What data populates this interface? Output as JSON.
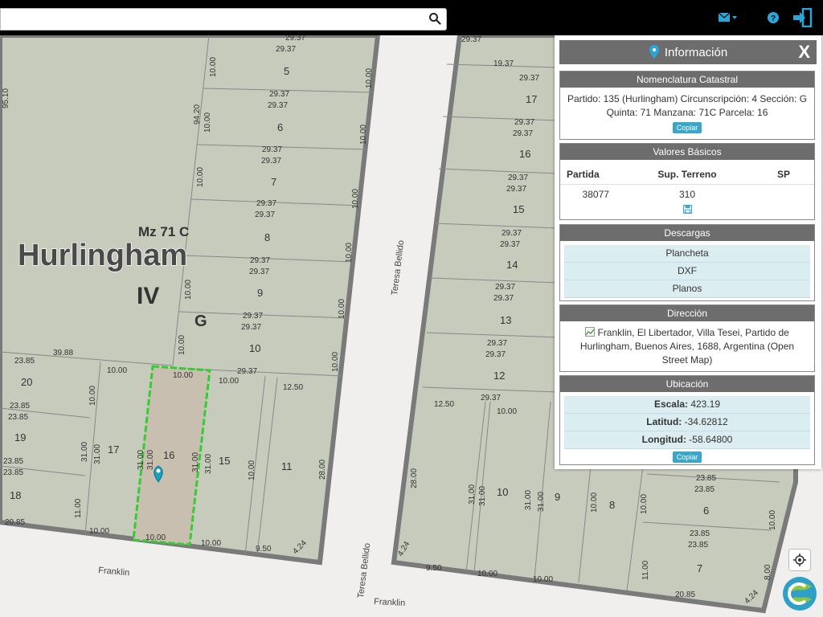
{
  "search": {
    "placeholder": "",
    "value": ""
  },
  "icons": {
    "search": "search-icon",
    "mail": "envelope-icon",
    "help": "question-circle-icon",
    "logout": "sign-out-icon",
    "locate": "crosshair-icon",
    "logo": "globe-logo-icon"
  },
  "colors": {
    "accent": "#3aa6c9",
    "parcel_highlight": "#33cc33",
    "header_gray": "#6d6d6d"
  },
  "map": {
    "block_label": "Mz 71 C",
    "locality": "Hurlingham",
    "circ": "IV",
    "section": "G",
    "streets": {
      "teresa_bellido_1": "Teresa Bellido",
      "teresa_bellido_2": "Teresa Bellido",
      "franklin_1": "Franklin",
      "franklin_2": "Franklin"
    },
    "parcels_left": {
      "p5": "5",
      "p6": "6",
      "p7": "7",
      "p8": "8",
      "p9": "9",
      "p10": "10",
      "p11": "11",
      "p15": "15",
      "p16": "16",
      "p17": "17",
      "p18": "18",
      "p19": "19",
      "p20": "20"
    },
    "parcels_right": {
      "p17": "17",
      "p16": "16",
      "p15": "15",
      "p14": "14",
      "p13": "13",
      "p12": "12",
      "p10": "10",
      "p9": "9",
      "p8": "8",
      "p7": "7",
      "p6": "6"
    },
    "dims": {
      "a1": "29.37",
      "a2": "29.37",
      "a3": "29.37",
      "a4": "29.37",
      "a5": "29.37",
      "a6": "29.37",
      "a7": "29.37",
      "a8": "29.37",
      "a9": "29.37",
      "a10": "29.37",
      "a11": "29.37",
      "a12": "29.37",
      "a13": "29.37",
      "v1": "10.00",
      "v2": "10.00",
      "v3": "10.00",
      "v4": "10.00",
      "v5": "10.00",
      "v6": "10.00",
      "v7": "10.00",
      "v8": "10.00",
      "v9": "10.00",
      "v10": "10.00",
      "v11": "10.00",
      "v12": "10.00",
      "v13": "10.00",
      "d9510": "95.10",
      "d9420": "94.20",
      "d3988": "39.88",
      "d2385a": "23.85",
      "d2385b": "23.85",
      "d2385c": "23.85",
      "d2385d": "23.85",
      "d2385e": "23.85",
      "d2085": "20.85",
      "h1000a": "10.00",
      "h1000b": "10.00",
      "h1000c": "10.00",
      "h1000d": "10.00",
      "h1000e": "10.00",
      "h1250": "12.50",
      "h950": "9.50",
      "h424": "4.24",
      "s3100a": "31.00",
      "s3100b": "31.00",
      "s3100c": "31.00",
      "s3100d": "31.00",
      "s3100e": "31.00",
      "s3100f": "31.00",
      "s2800": "28.00",
      "s1100": "11.00",
      "s1000": "10.00",
      "r1937": "19.37",
      "r2937a": "29.37",
      "r2937b": "29.37",
      "r2937c": "29.37",
      "r2937d": "29.37",
      "r2937e": "29.37",
      "r2937f": "29.37",
      "r2937g": "29.37",
      "r2937h": "29.37",
      "r2937i": "29.37",
      "r2937j": "29.37",
      "r2937k": "29.37",
      "r2937l": "29.37",
      "r2937m": "29.37",
      "r1250": "12.50",
      "r1000a": "10.00",
      "r2800": "28.00",
      "r3100a": "31.00",
      "r3100b": "31.00",
      "r3100c": "31.00",
      "r3100d": "31.00",
      "r1000b": "10.00",
      "r1000c": "10.00",
      "r950": "9.50",
      "r1000d": "10.00",
      "r424a": "4.24",
      "r424b": "4.24",
      "r2385a": "23.85",
      "r2385b": "23.85",
      "r2385c": "23.85",
      "r2385d": "23.85",
      "r1000e": "10.00",
      "r1100": "11.00",
      "r800": "8.00",
      "r2085": "20.85"
    }
  },
  "panel": {
    "title": "Información",
    "close": "X",
    "nomenclatura": {
      "header": "Nomenclatura Catastral",
      "text": "Partido: 135 (Hurlingham) Circunscripción: 4 Sección: G Quinta: 71 Manzana: 71C Parcela: 16",
      "copy": "Copiar"
    },
    "valores": {
      "header": "Valores Básicos",
      "col_partida": "Partida",
      "col_sup": "Sup. Terreno",
      "col_sp": "SP",
      "partida": "38077",
      "sup": "310",
      "sp": ""
    },
    "descargas": {
      "header": "Descargas",
      "items": [
        "Plancheta",
        "DXF",
        "Planos"
      ]
    },
    "direccion": {
      "header": "Dirección",
      "text": "Franklin, El Libertador, Villa Tesei, Partido de Hurlingham, Buenos Aires, 1688, Argentina (Open Street Map)"
    },
    "ubicacion": {
      "header": "Ubicación",
      "escala_label": "Escala:",
      "escala": "423.19",
      "lat_label": "Latitud:",
      "lat": "-34.62812",
      "lon_label": "Longitud:",
      "lon": "-58.64800",
      "copy": "Copiar"
    }
  }
}
